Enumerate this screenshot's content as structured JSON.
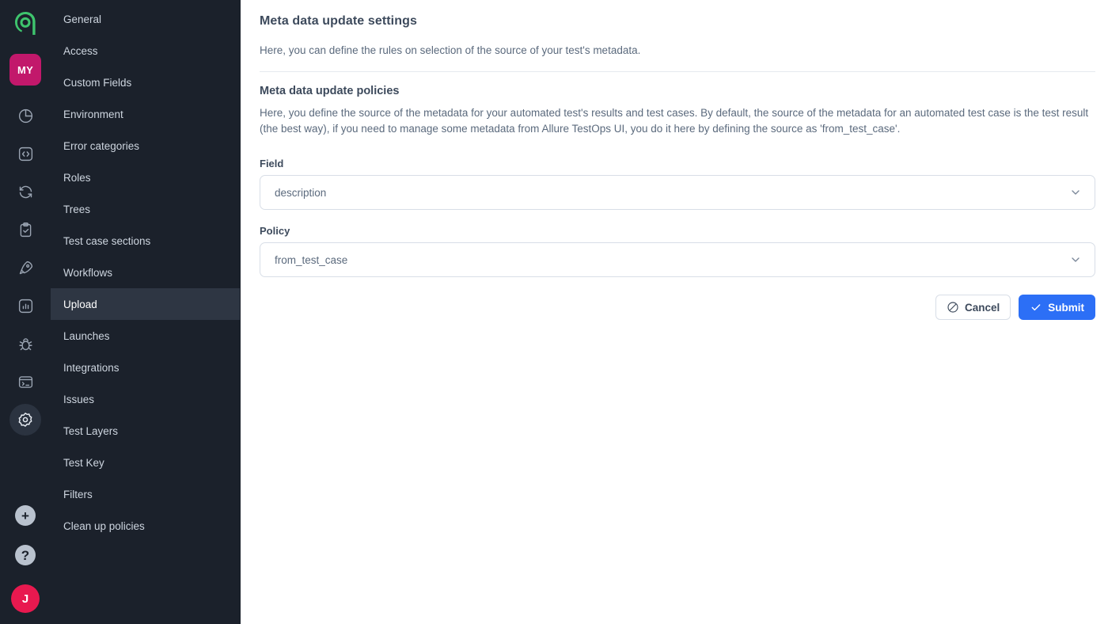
{
  "rail": {
    "logo_name": "allure-logo",
    "project_badge": "MY",
    "items": [
      {
        "name": "dashboards-icon",
        "label": "Dashboards"
      },
      {
        "name": "code-icon",
        "label": "API / Code"
      },
      {
        "name": "sync-icon",
        "label": "Jobs"
      },
      {
        "name": "clipboard-check-icon",
        "label": "Test cases"
      },
      {
        "name": "rocket-icon",
        "label": "Launches"
      },
      {
        "name": "bar-chart-icon",
        "label": "Analytics"
      },
      {
        "name": "bug-icon",
        "label": "Defects"
      },
      {
        "name": "terminal-icon",
        "label": "Console"
      },
      {
        "name": "gear-icon",
        "label": "Settings"
      }
    ],
    "add_label": "+",
    "help_label": "?",
    "avatar_initial": "J"
  },
  "sidebar": {
    "items": [
      {
        "label": "General",
        "active": false
      },
      {
        "label": "Access",
        "active": false
      },
      {
        "label": "Custom Fields",
        "active": false
      },
      {
        "label": "Environment",
        "active": false
      },
      {
        "label": "Error categories",
        "active": false
      },
      {
        "label": "Roles",
        "active": false
      },
      {
        "label": "Trees",
        "active": false
      },
      {
        "label": "Test case sections",
        "active": false
      },
      {
        "label": "Workflows",
        "active": false
      },
      {
        "label": "Upload",
        "active": true
      },
      {
        "label": "Launches",
        "active": false
      },
      {
        "label": "Integrations",
        "active": false
      },
      {
        "label": "Issues",
        "active": false
      },
      {
        "label": "Test Layers",
        "active": false
      },
      {
        "label": "Test Key",
        "active": false
      },
      {
        "label": "Filters",
        "active": false
      },
      {
        "label": "Clean up policies",
        "active": false
      }
    ]
  },
  "main": {
    "title": "Meta data update settings",
    "subtitle": "Here, you can define the rules on selection of the source of your test's metadata.",
    "section_title": "Meta data update policies",
    "section_body": "Here, you define the source of the metadata for your automated test's results and test cases. By default, the source of the metadata for an automated test case is the test result (the best way), if you need to manage some metadata from Allure TestOps UI, you do it here by defining the source as 'from_test_case'.",
    "fields": {
      "field": {
        "label": "Field",
        "value": "description"
      },
      "policy": {
        "label": "Policy",
        "value": "from_test_case"
      }
    },
    "actions": {
      "cancel_label": "Cancel",
      "submit_label": "Submit"
    }
  },
  "colors": {
    "rail_bg": "#1b212b",
    "sidebar_active": "#2e3643",
    "accent_blue": "#2c6ff6",
    "brand_green": "#34c759",
    "project_badge": "#c2186b",
    "avatar": "#e8194f"
  }
}
